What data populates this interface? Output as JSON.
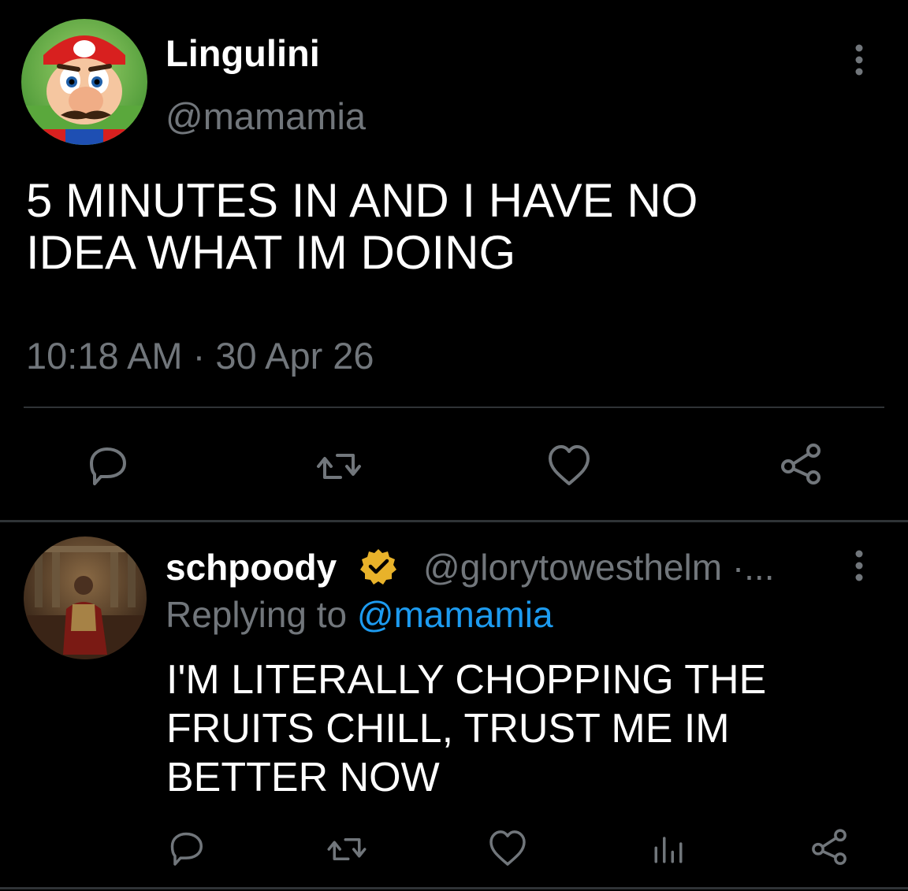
{
  "tweet": {
    "display_name": "Lingulini",
    "handle": "@mamamia",
    "text": "5 MINUTES IN AND I HAVE NO\nIDEA WHAT IM DOING",
    "timestamp": "10:18 AM · 30 Apr 26",
    "avatar": "cartoon-plumber-avatar"
  },
  "actions": [
    {
      "icon": "reply-icon"
    },
    {
      "icon": "retweet-icon"
    },
    {
      "icon": "like-icon"
    },
    {
      "icon": "share-icon"
    }
  ],
  "reply": {
    "display_name": "schpoody",
    "verified": true,
    "handle_meta": "@glorytowesthelm ·...",
    "replying_prefix": "Replying to ",
    "replying_mention": "@mamamia",
    "text": "I'M LITERALLY CHOPPING THE\nFRUITS CHILL, TRUST ME IM\nBETTER NOW",
    "avatar": "roman-general-avatar",
    "actions": [
      {
        "icon": "reply-icon"
      },
      {
        "icon": "retweet-icon"
      },
      {
        "icon": "like-icon"
      },
      {
        "icon": "views-icon"
      },
      {
        "icon": "share-icon"
      }
    ]
  },
  "colors": {
    "background": "#000000",
    "text_primary": "#ffffff",
    "text_secondary": "#71767b",
    "link": "#1d9bf0",
    "verified_gold": "#e8b22a",
    "divider": "#2f3336"
  }
}
